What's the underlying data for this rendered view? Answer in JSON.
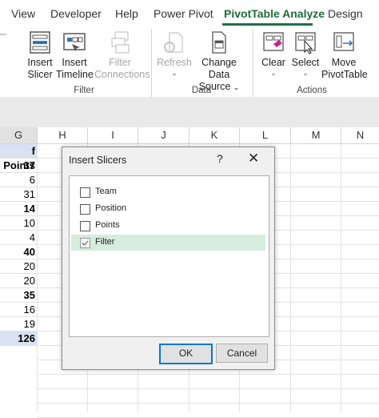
{
  "ribbon_tabs": [
    "View",
    "Developer",
    "Help",
    "Power Pivot",
    "PivotTable Analyze",
    "Design"
  ],
  "active_tab": "PivotTable Analyze",
  "groups": {
    "filter": {
      "label": "Filter",
      "insert_slicer": [
        "Insert",
        "Slicer"
      ],
      "insert_timeline": [
        "Insert",
        "Timeline"
      ],
      "filter_connections": [
        "Filter",
        "Connections"
      ]
    },
    "data": {
      "label": "Data",
      "refresh": [
        "Refresh"
      ],
      "change_source": [
        "Change Data",
        "Source"
      ]
    },
    "actions": {
      "label": "Actions",
      "clear": "Clear",
      "select": "Select",
      "move": [
        "Move",
        "PivotTable"
      ]
    }
  },
  "chevron": "⌄",
  "columns": [
    "G",
    "H",
    "I",
    "J",
    "K",
    "L",
    "M",
    "N"
  ],
  "column_g_header": "f Points",
  "column_g_values": [
    {
      "v": "37",
      "bold": true,
      "hl": false
    },
    {
      "v": "6",
      "bold": false,
      "hl": false
    },
    {
      "v": "31",
      "bold": false,
      "hl": false
    },
    {
      "v": "14",
      "bold": true,
      "hl": false
    },
    {
      "v": "10",
      "bold": false,
      "hl": false
    },
    {
      "v": "4",
      "bold": false,
      "hl": false
    },
    {
      "v": "40",
      "bold": true,
      "hl": false
    },
    {
      "v": "20",
      "bold": false,
      "hl": false
    },
    {
      "v": "20",
      "bold": false,
      "hl": false
    },
    {
      "v": "35",
      "bold": true,
      "hl": false
    },
    {
      "v": "16",
      "bold": false,
      "hl": false
    },
    {
      "v": "19",
      "bold": false,
      "hl": false
    },
    {
      "v": "126",
      "bold": true,
      "hl": true
    }
  ],
  "dialog": {
    "title": "Insert Slicers",
    "help": "?",
    "close": "✕",
    "fields": [
      {
        "label": "Team",
        "checked": false,
        "selected": false
      },
      {
        "label": "Position",
        "checked": false,
        "selected": false
      },
      {
        "label": "Points",
        "checked": false,
        "selected": false
      },
      {
        "label": "Filter",
        "checked": true,
        "selected": true
      }
    ],
    "ok": "OK",
    "cancel": "Cancel"
  },
  "colors": {
    "accent_green": "#1e7145",
    "selection_green": "#d5ecdf",
    "total_highlight": "#d9e1f2",
    "ok_border": "#0078d7"
  }
}
